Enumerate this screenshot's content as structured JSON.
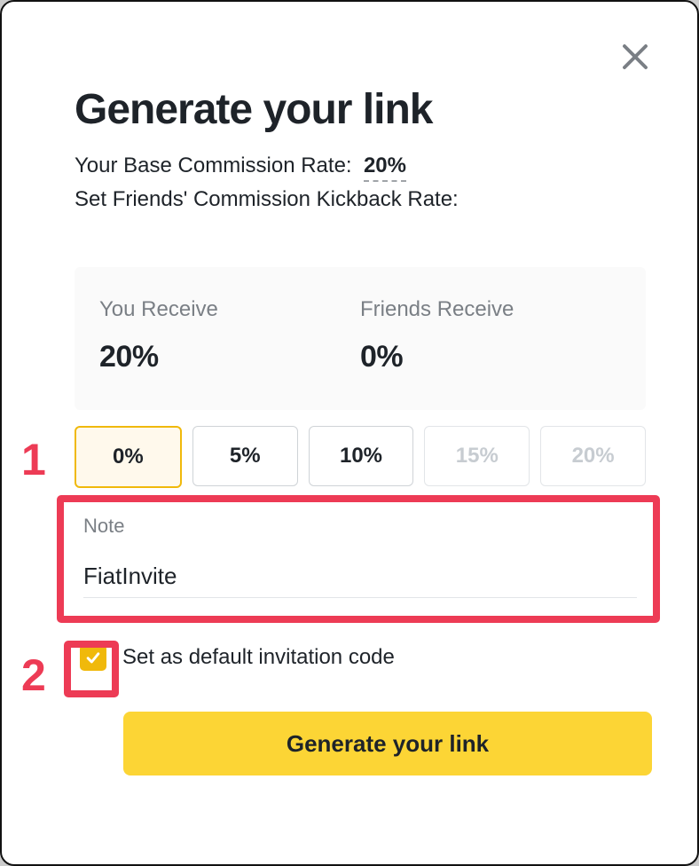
{
  "title": "Generate your link",
  "baseRateLabel": "Your Base Commission Rate:",
  "baseRateValue": "20%",
  "friendsRateLabel": "Set Friends' Commission Kickback Rate:",
  "youReceiveLabel": "You Receive",
  "youReceiveValue": "20%",
  "friendsReceiveLabel": "Friends Receive",
  "friendsReceiveValue": "0%",
  "options": {
    "o0": "0%",
    "o1": "5%",
    "o2": "10%",
    "o3": "15%",
    "o4": "20%"
  },
  "noteLabel": "Note",
  "noteValue": "FiatInvite",
  "defaultLabel": "Set as default invitation code",
  "defaultChecked": true,
  "generateLabel": "Generate your link",
  "markers": {
    "m1": "1",
    "m2": "2"
  },
  "colors": {
    "accent": "#f0b90b",
    "highlight": "#ed3b55",
    "button": "#fcd535"
  }
}
